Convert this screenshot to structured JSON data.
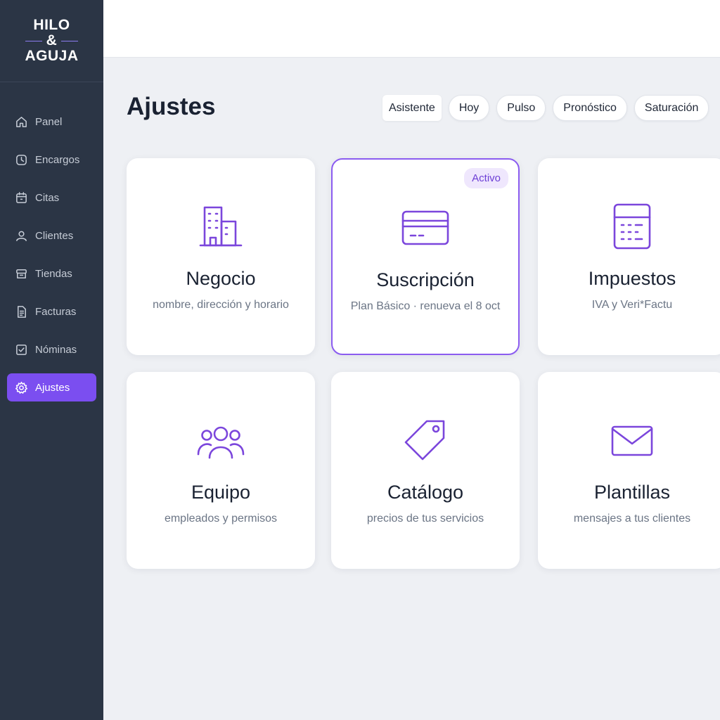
{
  "brand": {
    "line1": "HILO",
    "amp": "&",
    "line2": "AGUJA"
  },
  "sidebar": {
    "items": [
      {
        "label": "Panel",
        "icon": "home-icon"
      },
      {
        "label": "Encargos",
        "icon": "clock-icon"
      },
      {
        "label": "Citas",
        "icon": "calendar-icon"
      },
      {
        "label": "Clientes",
        "icon": "user-icon"
      },
      {
        "label": "Tiendas",
        "icon": "store-icon"
      },
      {
        "label": "Facturas",
        "icon": "invoice-icon"
      },
      {
        "label": "Nóminas",
        "icon": "payroll-icon"
      },
      {
        "label": "Ajustes",
        "icon": "gear-icon",
        "active": true
      }
    ]
  },
  "page": {
    "title": "Ajustes"
  },
  "quick_filters": [
    "Asistente",
    "Hoy",
    "Pulso",
    "Pronóstico",
    "Saturación"
  ],
  "cards": [
    {
      "title": "Negocio",
      "subtitle": "nombre, dirección y horario",
      "icon": "building-icon"
    },
    {
      "title": "Suscripción",
      "subtitle": "Plan Básico · renueva el 8 oct",
      "icon": "credit-card-icon",
      "badge": "Activo"
    },
    {
      "title": "Impuestos",
      "subtitle": "IVA y Veri*Factu",
      "icon": "calculator-icon"
    },
    {
      "title": "Equipo",
      "subtitle": "empleados y permisos",
      "icon": "team-icon"
    },
    {
      "title": "Catálogo",
      "subtitle": "precios de tus servicios",
      "icon": "tag-icon"
    },
    {
      "title": "Plantillas",
      "subtitle": "mensajes a tus clientes",
      "icon": "mail-icon"
    }
  ],
  "colors": {
    "sidebar_bg": "#2b3545",
    "accent": "#7b4ef0",
    "icon_purple": "#7b46dc",
    "page_bg": "#eef0f4"
  }
}
